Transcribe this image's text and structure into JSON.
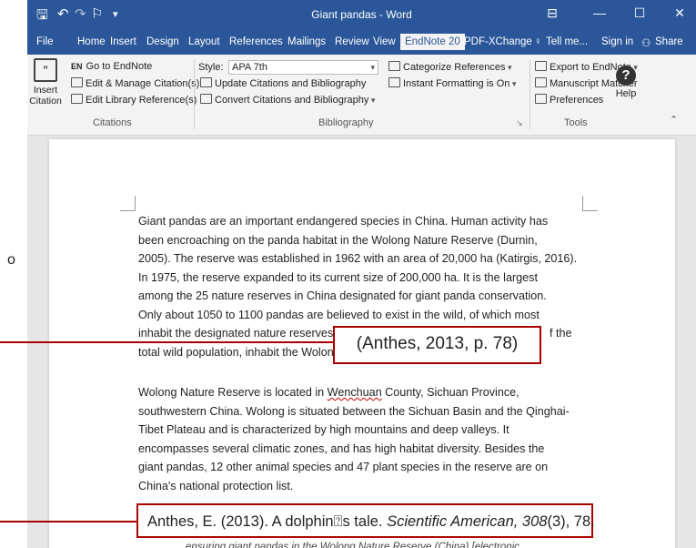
{
  "window": {
    "title": "Giant pandas - Word",
    "minimize": "—",
    "maximize": "☐",
    "close": "✕"
  },
  "tabs": [
    "File",
    "Home",
    "Insert",
    "Design",
    "Layout",
    "References",
    "Mailings",
    "Review",
    "View",
    "EndNote 20",
    "PDF-XChange"
  ],
  "active_tab": "EndNote 20",
  "tell_me": "Tell me...",
  "sign_in": "Sign in",
  "share": "Share",
  "ribbon": {
    "insert_citation": "Insert\nCitation",
    "go_to_endnote": "Go to EndNote",
    "edit_manage": "Edit & Manage Citation(s)",
    "edit_library": "Edit Library Reference(s)",
    "citations_group": "Citations",
    "style_label": "Style:",
    "style_value": "APA 7th",
    "update_citations": "Update Citations and Bibliography",
    "convert_citations": "Convert Citations and Bibliography",
    "categorize": "Categorize References",
    "instant_formatting": "Instant Formatting is On",
    "bibliography_group": "Bibliography",
    "export_endnote": "Export to EndNote",
    "manuscript_matcher": "Manuscript Matcher",
    "preferences": "Preferences",
    "help": "Help",
    "tools_group": "Tools"
  },
  "doc": {
    "para1": [
      "Giant pandas are an important endangered species in China.    Human activity has",
      "been encroaching on the panda habitat in the Wolong Nature Reserve (Durnin,",
      "2005). The reserve was established in 1962 with an area of 20,000 ha (Katirgis, 2016).",
      "In 1975, the reserve expanded to its current size of 200,000 ha. It is the largest",
      "among the 25 nature reserves in China designated for giant panda conservation.",
      "Only about 1050 to 1100 pandas are believed to exist in the wild, of which most",
      "inhabit the designated nature reserves.",
      "total wild population, inhabit the Wolon"
    ],
    "para1_tail": "f the",
    "para2_l1_a": "Wolong Nature Reserve is located in ",
    "para2_l1_b": "Wenchuan",
    "para2_l1_c": " County, Sichuan Province,",
    "para2": [
      "southwestern China. Wolong is situated between the Sichuan Basin and the Qinghai-",
      "Tibet Plateau and is characterized by high mountains and deep valleys.    It",
      "encompasses several climatic zones, and has high habitat diversity.    Besides the",
      "giant pandas, 12 other animal species and 47 plant species in the reserve are on",
      "China's national protection list."
    ],
    "cut_line": "ensuring giant pandas in the Wolong Nature Reserve (China) [electronic"
  },
  "callouts": {
    "citation": "(Anthes, 2013, p. 78)",
    "ref_author": "Anthes, E. (2013). A dolphin",
    "ref_glyph": "⍰",
    "ref_title": "s tale. ",
    "ref_journal": "Scientific American, 308",
    "ref_issue": "(3), 78."
  },
  "outside_mark": "o"
}
